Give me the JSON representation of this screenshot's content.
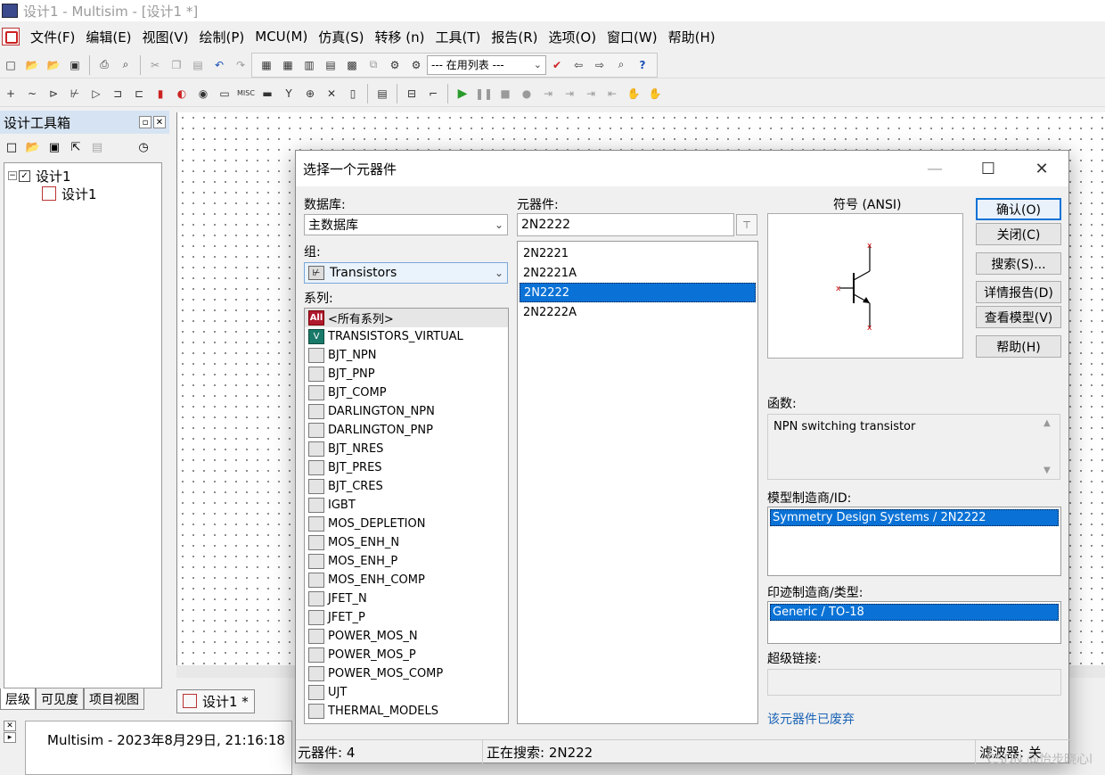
{
  "app": {
    "title": "设计1 - Multisim - [设计1 *]"
  },
  "menu": [
    "文件(F)",
    "编辑(E)",
    "视图(V)",
    "绘制(P)",
    "MCU(M)",
    "仿真(S)",
    "转移 (n)",
    "工具(T)",
    "报告(R)",
    "选项(O)",
    "窗口(W)",
    "帮助(H)"
  ],
  "toolbar": {
    "in_use_list": "--- 在用列表 ---"
  },
  "toolbox": {
    "title": "设计工具箱",
    "tree_root": "设计1",
    "tree_child": "设计1",
    "tabs": [
      "层级",
      "可见度",
      "项目视图"
    ]
  },
  "doc_tab": "设计1 *",
  "log": {
    "line": "Multisim  -  2023年8月29日, 21:16:18"
  },
  "dialog": {
    "title": "选择一个元器件",
    "database_label": "数据库:",
    "database_value": "主数据库",
    "group_label": "组:",
    "group_value": "Transistors",
    "series_label": "系列:",
    "series": [
      {
        "icon": "All",
        "label": "<所有系列>"
      },
      {
        "icon": "V",
        "label": "TRANSISTORS_VIRTUAL"
      },
      {
        "icon": "",
        "label": "BJT_NPN"
      },
      {
        "icon": "",
        "label": "BJT_PNP"
      },
      {
        "icon": "",
        "label": "BJT_COMP"
      },
      {
        "icon": "",
        "label": "DARLINGTON_NPN"
      },
      {
        "icon": "",
        "label": "DARLINGTON_PNP"
      },
      {
        "icon": "",
        "label": "BJT_NRES"
      },
      {
        "icon": "",
        "label": "BJT_PRES"
      },
      {
        "icon": "",
        "label": "BJT_CRES"
      },
      {
        "icon": "",
        "label": "IGBT"
      },
      {
        "icon": "",
        "label": "MOS_DEPLETION"
      },
      {
        "icon": "",
        "label": "MOS_ENH_N"
      },
      {
        "icon": "",
        "label": "MOS_ENH_P"
      },
      {
        "icon": "",
        "label": "MOS_ENH_COMP"
      },
      {
        "icon": "",
        "label": "JFET_N"
      },
      {
        "icon": "",
        "label": "JFET_P"
      },
      {
        "icon": "",
        "label": "POWER_MOS_N"
      },
      {
        "icon": "",
        "label": "POWER_MOS_P"
      },
      {
        "icon": "",
        "label": "POWER_MOS_COMP"
      },
      {
        "icon": "",
        "label": "UJT"
      },
      {
        "icon": "",
        "label": "THERMAL_MODELS"
      }
    ],
    "component_label": "元器件:",
    "component_value": "2N2222",
    "components": [
      "2N2221",
      "2N2221A",
      "2N2222",
      "2N2222A"
    ],
    "selected_component": "2N2222",
    "symbol_label": "符号 (ANSI)",
    "buttons": {
      "ok": "确认(O)",
      "close": "关闭(C)",
      "search": "搜索(S)...",
      "details": "详情报告(D)",
      "view_model": "查看模型(V)",
      "help": "帮助(H)"
    },
    "function_label": "函数:",
    "function_value": "NPN switching transistor",
    "model_label": "模型制造商/ID:",
    "model_value": "Symmetry Design Systems / 2N2222",
    "footprint_label": "印迹制造商/类型:",
    "footprint_value": "Generic / TO-18",
    "hyperlink_label": "超级链接:",
    "deprecated_link": "该元器件已废弃",
    "status": {
      "count": "元器件:  4",
      "searching": "正在搜索:  2N222",
      "filter": "滤波器:  关"
    }
  },
  "watermark": "CSDN @怡步晓心l"
}
